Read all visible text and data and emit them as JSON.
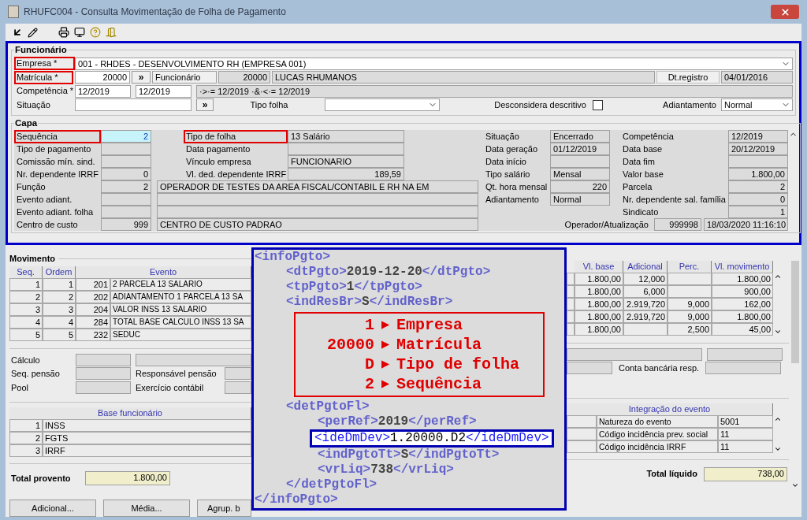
{
  "window": {
    "title": "RHUFC004 - Consulta Movimentação de Folha de Pagamento"
  },
  "funcionario": {
    "title": "Funcionário",
    "empresa": {
      "label": "Empresa *",
      "marked": true,
      "value": "001 - RHDES - DESENVOLVIMENTO RH (EMPRESA 001)"
    },
    "matricula": {
      "label": "Matrícula *",
      "marked": true,
      "value": "20000",
      "button": "»",
      "funcionario_label": "Funcionário",
      "funcionario_code": "20000",
      "funcionario_name": "LUCAS RHUMANOS",
      "dt_label": "Dt.registro",
      "dt_value": "04/01/2016"
    },
    "competencia": {
      "label": "Competência *",
      "marked": false,
      "from": "12/2019",
      "to": "12/2019",
      "expression": "·>·= 12/2019 ·&·<·= 12/2019"
    },
    "situacao": {
      "label": "Situação",
      "marked": false,
      "button": "»",
      "tipo_label": "Tipo folha",
      "descons_label": "Desconsidera descritivo",
      "descons_checked": false,
      "adiant_label": "Adiantamento",
      "adiant_value": "Normal"
    }
  },
  "capa": {
    "title": "Capa",
    "left": [
      {
        "first": {
          "label": "Sequência",
          "value": "2",
          "kind": "number",
          "marked": true,
          "focused": true
        },
        "second": {
          "kind": "pair",
          "label": "Tipo de folha",
          "value": "13 Salário",
          "numeric": false,
          "marked": true
        }
      },
      {
        "first": {
          "label": "Tipo de pagamento",
          "kind": "text",
          "marked": false,
          "focused": false
        },
        "second": {
          "kind": "pair",
          "label": "Data pagamento",
          "marked": false
        }
      },
      {
        "first": {
          "label": "Comissão mín. sind.",
          "kind": "text",
          "marked": false,
          "focused": false
        },
        "second": {
          "kind": "pair",
          "label": "Vínculo empresa",
          "value": "FUNCIONARIO",
          "numeric": false,
          "marked": false
        }
      },
      {
        "first": {
          "label": "Nr. dependente IRRF",
          "value": "0",
          "kind": "number",
          "marked": false,
          "focused": false
        },
        "second": {
          "kind": "pair",
          "label": "Vl. ded. dependente IRRF",
          "value": "189,59",
          "numeric": true,
          "marked": false
        }
      },
      {
        "first": {
          "label": "Função",
          "value": "2",
          "kind": "number",
          "marked": false,
          "focused": false
        },
        "second": {
          "kind": "description",
          "text": "OPERADOR DE TESTES DA AREA FISCAL/CONTABIL E RH NA EM"
        }
      },
      {
        "first": {
          "label": "Evento adiant.",
          "kind": "text",
          "marked": false,
          "focused": false
        },
        "second": {
          "kind": "description"
        }
      },
      {
        "first": {
          "label": "Evento adiant. folha",
          "kind": "text",
          "marked": false,
          "focused": false
        },
        "second": {
          "kind": "description"
        }
      },
      {
        "first": {
          "label": "Centro de custo",
          "value": "999",
          "kind": "number",
          "marked": false,
          "focused": false
        },
        "second": {
          "kind": "description",
          "text": "CENTRO DE CUSTO PADRAO"
        }
      }
    ],
    "right": [
      {
        "first": {
          "label": "Situação",
          "value": "Encerrado",
          "kind": "text"
        },
        "second": {
          "label": "Competência",
          "value": "12/2019",
          "kind": "text"
        }
      },
      {
        "first": {
          "label": "Data geração",
          "value": "01/12/2019",
          "kind": "text"
        },
        "second": {
          "label": "Data base",
          "value": "20/12/2019",
          "kind": "text"
        }
      },
      {
        "first": {
          "label": "Data início",
          "kind": "text"
        },
        "second": {
          "label": "Data fim",
          "kind": "text"
        }
      },
      {
        "first": {
          "label": "Tipo salário",
          "value": "Mensal",
          "kind": "text"
        },
        "second": {
          "label": "Valor base",
          "value": "1.800,00",
          "kind": "number"
        }
      },
      {
        "first": {
          "label": "Qt. hora mensal",
          "value": "220",
          "kind": "number"
        },
        "second": {
          "label": "Parcela",
          "value": "2",
          "kind": "number"
        }
      },
      {
        "first": {
          "label": "Adiantamento",
          "value": "Normal",
          "kind": "text"
        },
        "second": {
          "label": "Nr. dependente sal. família",
          "value": "0",
          "kind": "number"
        }
      },
      {
        "second": {
          "label": "Sindicato",
          "value": "1",
          "kind": "number"
        }
      }
    ],
    "operador": {
      "label": "Operador/Atualização",
      "code": "999998",
      "datetime": "18/03/2020 11:16:10"
    }
  },
  "movimento": {
    "title": "Movimento",
    "columns": [
      "Seq.",
      "Ordem",
      "Evento",
      "Vl. base",
      "Adicional",
      "Perc.",
      "Vl. movimento"
    ],
    "rows": [
      {
        "seq": "1",
        "ordem": "1",
        "code": "201",
        "evento": "2 PARCELA 13 SALARIO",
        "vl_base": "1.800,00",
        "adicional": "12,000",
        "vl_movimento": "1.800,00"
      },
      {
        "seq": "2",
        "ordem": "2",
        "code": "202",
        "evento": "ADIANTAMENTO 1 PARCELA 13 SA",
        "vl_base": "1.800,00",
        "adicional": "6,000",
        "vl_movimento": "900,00"
      },
      {
        "seq": "3",
        "ordem": "3",
        "code": "204",
        "evento": "VALOR INSS 13 SALARIO",
        "vl_base": "1.800,00",
        "adicional": "2.919,720",
        "perc": "9,000",
        "vl_movimento": "162,00"
      },
      {
        "seq": "4",
        "ordem": "4",
        "code": "284",
        "evento": "TOTAL BASE CALCULO INSS 13 SA",
        "vl_base": "1.800,00",
        "adicional": "2.919,720",
        "perc": "9,000",
        "vl_movimento": "1.800,00"
      },
      {
        "seq": "5",
        "ordem": "5",
        "code": "232",
        "evento": "SEDUC",
        "vl_base": "1.800,00",
        "perc": "2,500",
        "vl_movimento": "45,00"
      }
    ]
  },
  "details": {
    "calculo_label": "Cálculo",
    "seq_pensao_label": "Seq. pensão",
    "pool_label": "Pool",
    "responsavel_label": "Responsável pensão",
    "exercicio_label": "Exercício contábil",
    "conta_label": "Conta bancária resp."
  },
  "bases": {
    "title": "Base funcionário",
    "rows": [
      {
        "code": "1",
        "name": "INSS"
      },
      {
        "code": "2",
        "name": "FGTS"
      },
      {
        "code": "3",
        "name": "IRRF"
      }
    ]
  },
  "integracao": {
    "title": "Integração do evento",
    "rows": [
      {
        "label": "Natureza do evento",
        "value": "5001"
      },
      {
        "label": "Código incidência prev. social",
        "value": "11"
      },
      {
        "label": "Código incidência IRRF",
        "value": "11"
      }
    ]
  },
  "totals": {
    "provento_label": "Total provento",
    "provento": "1.800,00",
    "liquido_label": "Total líquido",
    "liquido": "738,00"
  },
  "buttons": [
    "Adicional...",
    "Média...",
    "Agrup. b"
  ],
  "xml": {
    "kind": "element",
    "open": "<infoPgto>",
    "close": "</infoPgto>",
    "children": [
      {
        "kind": "element",
        "open": "<dtPgto>",
        "value": "2019-12-20",
        "close": "</dtPgto>",
        "highlighted": false
      },
      {
        "kind": "element",
        "open": "<tpPgto>",
        "value": "1",
        "close": "</tpPgto>",
        "highlighted": false
      },
      {
        "kind": "element",
        "open": "<indResBr>",
        "value": "S",
        "close": "</indResBr>",
        "highlighted": false
      },
      {
        "kind": "annotation",
        "lines": [
          {
            "value": "1",
            "arrow": "▶",
            "label": "Empresa"
          },
          {
            "value": "20000",
            "arrow": "▶",
            "label": "Matrícula"
          },
          {
            "value": "D",
            "arrow": "▶",
            "label": "Tipo de folha"
          },
          {
            "value": "2",
            "arrow": "▶",
            "label": "Sequência"
          }
        ]
      },
      {
        "kind": "element",
        "open": "<detPgtoFl>",
        "close": "</detPgtoFl>",
        "children": [
          {
            "kind": "element",
            "open": "<perRef>",
            "value": "2019",
            "close": "</perRef>",
            "highlighted": false
          },
          {
            "kind": "element",
            "open": "<ideDmDev>",
            "value": "1.20000.D2",
            "close": "</ideDmDev>",
            "highlighted": true
          },
          {
            "kind": "element",
            "open": "<indPgtoTt>",
            "value": "S",
            "close": "</indPgtoTt>",
            "highlighted": false
          },
          {
            "kind": "element",
            "open": "<vrLiq>",
            "value": "738",
            "close": "</vrLiq>",
            "highlighted": false
          }
        ]
      }
    ]
  }
}
